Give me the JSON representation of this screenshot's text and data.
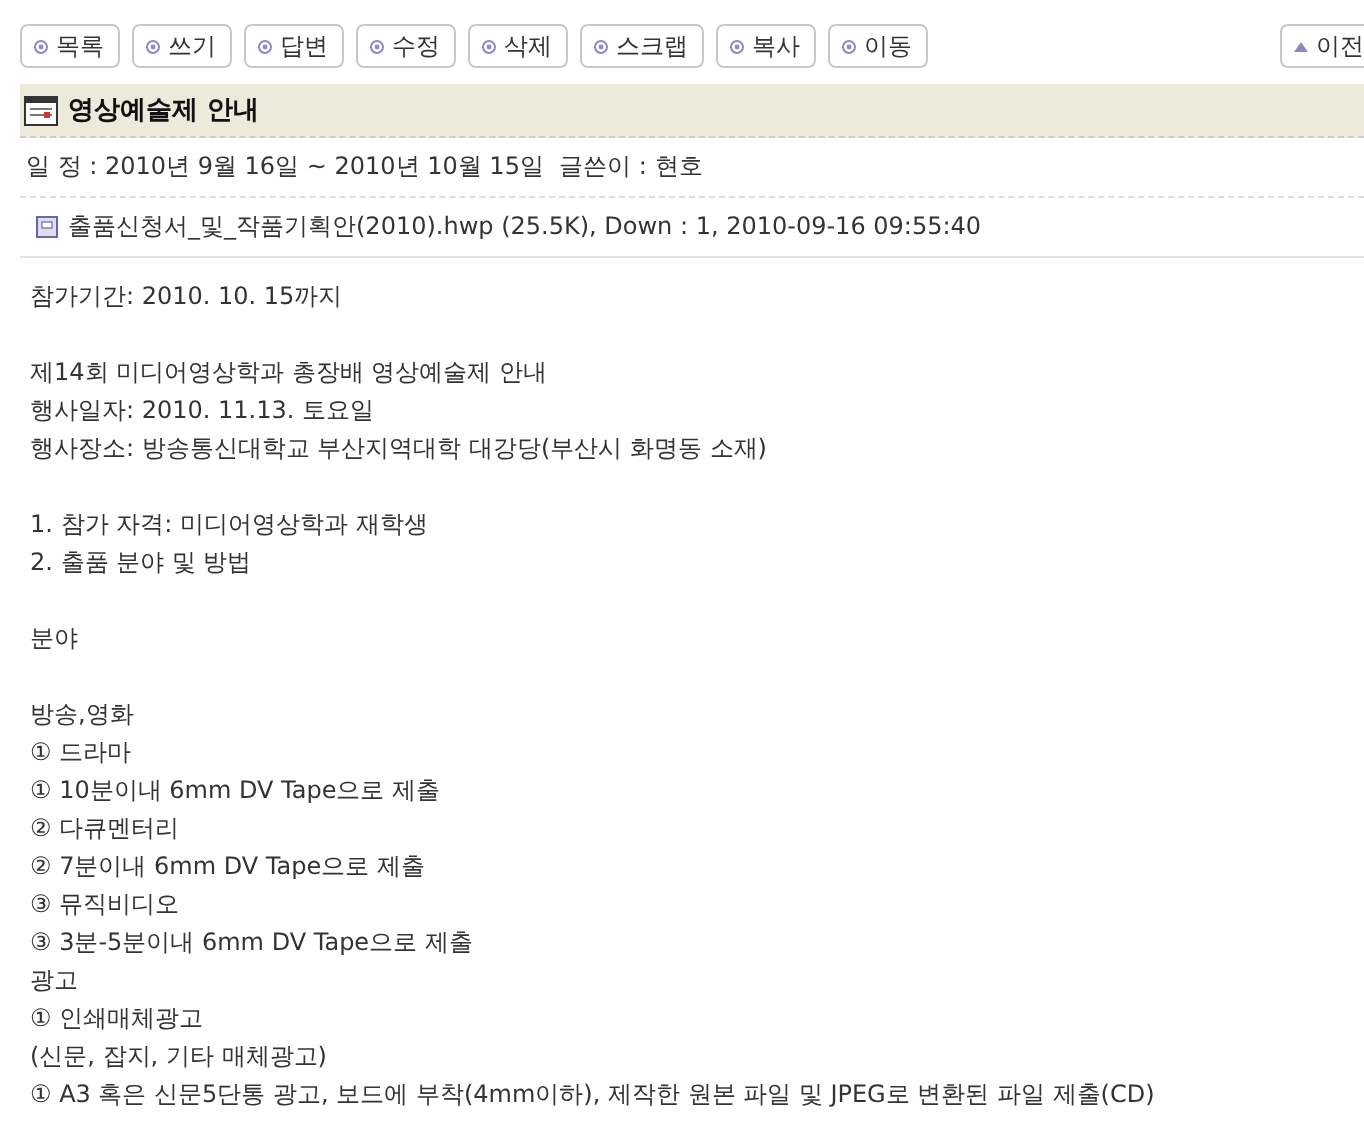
{
  "toolbar": {
    "buttons": [
      {
        "label": "목록"
      },
      {
        "label": "쓰기"
      },
      {
        "label": "답변"
      },
      {
        "label": "수정"
      },
      {
        "label": "삭제"
      },
      {
        "label": "스크랩"
      },
      {
        "label": "복사"
      },
      {
        "label": "이동"
      }
    ],
    "prev_button": {
      "label": "이전"
    }
  },
  "post": {
    "title": "영상예술제 안내",
    "meta": "일 정 : 2010년 9월 16일 ~ 2010년 10월 15일  글쓴이 : 현호",
    "attachment": "출품신청서_및_작품기획안(2010).hwp (25.5K), Down : 1, 2010-09-16 09:55:40",
    "paragraphs": [
      [
        "참가기간: 2010. 10. 15까지"
      ],
      [
        "제14회 미디어영상학과 총장배 영상예술제 안내",
        "행사일자: 2010. 11.13. 토요일",
        "행사장소: 방송통신대학교 부산지역대학 대강당(부산시 화명동 소재)"
      ],
      [
        "1. 참가 자격: 미디어영상학과 재학생",
        "2. 출품 분야 및 방법"
      ],
      [
        "분야"
      ],
      [
        "방송,영화",
        "① 드라마",
        "① 10분이내 6mm DV Tape으로 제출",
        "② 다큐멘터리",
        "② 7분이내 6mm DV Tape으로 제출",
        "③ 뮤직비디오",
        "③ 3분-5분이내 6mm DV Tape으로 제출",
        "광고",
        "① 인쇄매체광고",
        "(신문, 잡지, 기타 매체광고)",
        "① A3 혹은 신문5단통 광고, 보드에 부착(4mm이하), 제작한 원본 파일 및 JPEG로 변환된 파일 제출(CD)"
      ]
    ]
  }
}
